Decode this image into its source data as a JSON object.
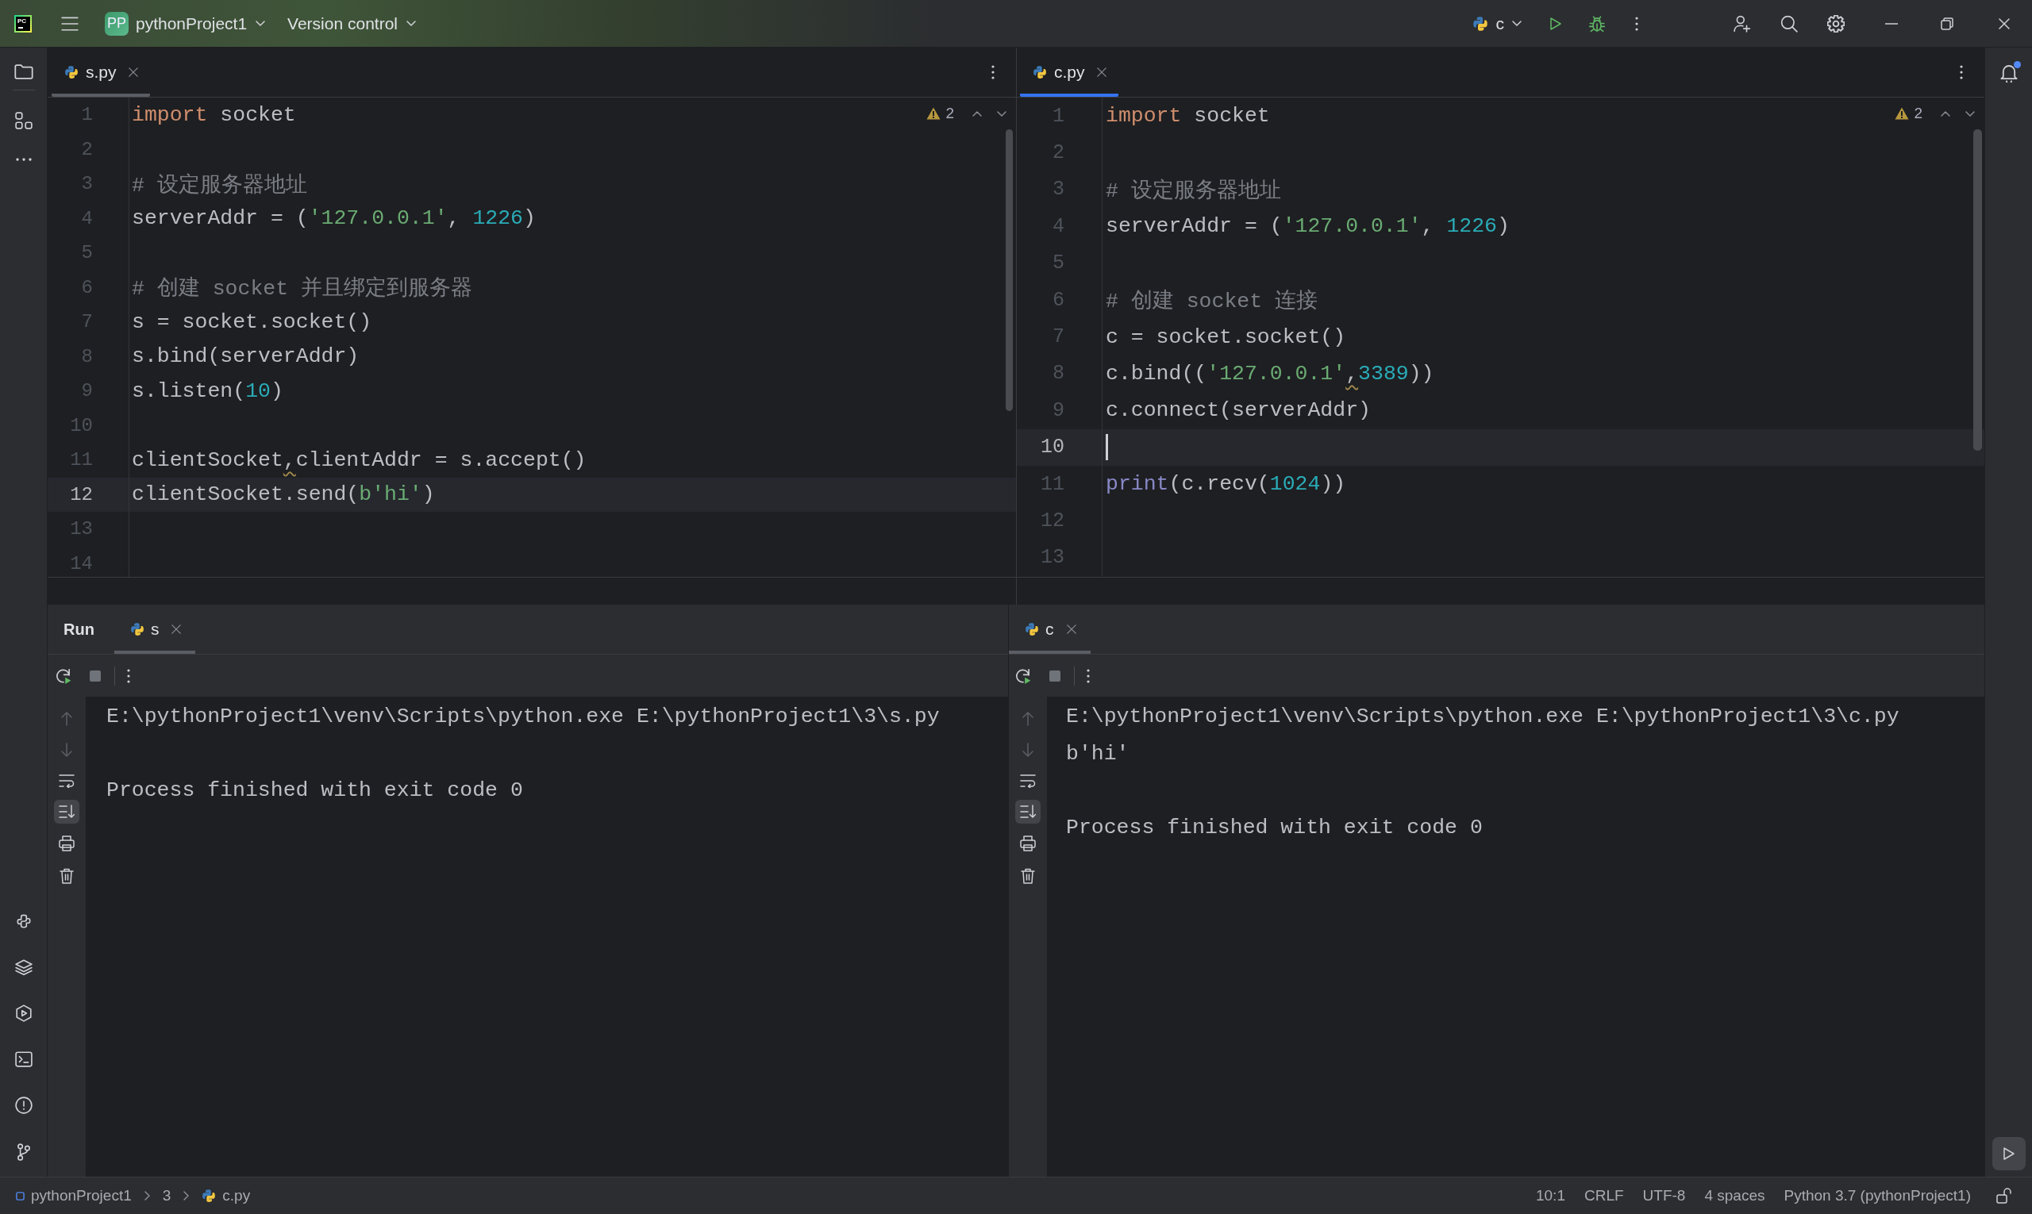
{
  "title_bar": {
    "app_logo": "PC",
    "project_badge": "PP",
    "project_name": "pythonProject1",
    "vcs_menu": "Version control",
    "run_configuration": "c"
  },
  "editors": [
    {
      "focused": false,
      "tabs": [
        {
          "label": "s.py",
          "selected": true
        }
      ],
      "warnings": "2",
      "lines": [
        {
          "number": "1",
          "current": false,
          "tokens": [
            {
              "kind": "keyword",
              "text": "import"
            },
            {
              "kind": "plain",
              "text": " socket"
            }
          ]
        },
        {
          "number": "2",
          "current": false
        },
        {
          "number": "3",
          "current": false,
          "tokens": [
            {
              "kind": "comment",
              "text": "# 设定服务器地址"
            }
          ]
        },
        {
          "number": "4",
          "current": false,
          "tokens": [
            {
              "kind": "plain",
              "text": "serverAddr = ("
            },
            {
              "kind": "string",
              "text": "'127.0.0.1'"
            },
            {
              "kind": "plain",
              "text": ", "
            },
            {
              "kind": "number",
              "text": "1226"
            },
            {
              "kind": "plain",
              "text": ")"
            }
          ]
        },
        {
          "number": "5",
          "current": false
        },
        {
          "number": "6",
          "current": false,
          "tokens": [
            {
              "kind": "comment",
              "text": "# 创建 socket 并且绑定到服务器"
            }
          ]
        },
        {
          "number": "7",
          "current": false,
          "tokens": [
            {
              "kind": "plain",
              "text": "s = socket.socket()"
            }
          ]
        },
        {
          "number": "8",
          "current": false,
          "tokens": [
            {
              "kind": "plain",
              "text": "s.bind(serverAddr)"
            }
          ]
        },
        {
          "number": "9",
          "current": false,
          "tokens": [
            {
              "kind": "plain",
              "text": "s.listen("
            },
            {
              "kind": "number",
              "text": "10"
            },
            {
              "kind": "plain",
              "text": ")"
            }
          ]
        },
        {
          "number": "10",
          "current": false
        },
        {
          "number": "11",
          "current": false,
          "tokens": [
            {
              "kind": "plain",
              "text": "clientSocket"
            },
            {
              "kind": "warning",
              "text": ","
            },
            {
              "kind": "plain",
              "text": "clientAddr = s.accept()"
            }
          ]
        },
        {
          "number": "12",
          "current": true,
          "tokens": [
            {
              "kind": "plain",
              "text": "clientSocket.send("
            },
            {
              "kind": "string",
              "text": "b'hi'"
            },
            {
              "kind": "plain",
              "text": ")"
            }
          ]
        },
        {
          "number": "13",
          "current": false
        },
        {
          "number": "14",
          "current": false
        }
      ]
    },
    {
      "focused": true,
      "tabs": [
        {
          "label": "c.py",
          "selected": true
        }
      ],
      "warnings": "2",
      "lines": [
        {
          "number": "1",
          "current": false,
          "tokens": [
            {
              "kind": "keyword",
              "text": "import"
            },
            {
              "kind": "plain",
              "text": " socket"
            }
          ]
        },
        {
          "number": "2",
          "current": false
        },
        {
          "number": "3",
          "current": false,
          "tokens": [
            {
              "kind": "comment",
              "text": "# 设定服务器地址"
            }
          ]
        },
        {
          "number": "4",
          "current": false,
          "tokens": [
            {
              "kind": "plain",
              "text": "serverAddr = ("
            },
            {
              "kind": "string",
              "text": "'127.0.0.1'"
            },
            {
              "kind": "plain",
              "text": ", "
            },
            {
              "kind": "number",
              "text": "1226"
            },
            {
              "kind": "plain",
              "text": ")"
            }
          ]
        },
        {
          "number": "5",
          "current": false
        },
        {
          "number": "6",
          "current": false,
          "tokens": [
            {
              "kind": "comment",
              "text": "# 创建 socket 连接"
            }
          ]
        },
        {
          "number": "7",
          "current": false,
          "tokens": [
            {
              "kind": "plain",
              "text": "c = socket.socket()"
            }
          ]
        },
        {
          "number": "8",
          "current": false,
          "tokens": [
            {
              "kind": "plain",
              "text": "c.bind(("
            },
            {
              "kind": "string",
              "text": "'127.0.0.1'"
            },
            {
              "kind": "warning",
              "text": ","
            },
            {
              "kind": "number",
              "text": "3389"
            },
            {
              "kind": "plain",
              "text": "))"
            }
          ]
        },
        {
          "number": "9",
          "current": false,
          "tokens": [
            {
              "kind": "plain",
              "text": "c.connect(serverAddr)"
            }
          ]
        },
        {
          "number": "10",
          "current": true
        },
        {
          "number": "11",
          "current": false,
          "tokens": [
            {
              "kind": "builtin",
              "text": "print"
            },
            {
              "kind": "plain",
              "text": "(c.recv("
            },
            {
              "kind": "number",
              "text": "1024"
            },
            {
              "kind": "plain",
              "text": "))"
            }
          ]
        },
        {
          "number": "12",
          "current": false
        },
        {
          "number": "13",
          "current": false
        }
      ]
    }
  ],
  "run_panel": {
    "title": "Run",
    "consoles": [
      {
        "tabs": [
          {
            "label": "s",
            "selected": true
          }
        ],
        "running": false,
        "soft_wrap": false,
        "scroll_to_end": true,
        "output": [
          "E:\\pythonProject1\\venv\\Scripts\\python.exe E:\\pythonProject1\\3\\s.py"
        ],
        "exit_message": "Process finished with exit code 0"
      },
      {
        "tabs": [
          {
            "label": "c",
            "selected": true
          }
        ],
        "running": false,
        "soft_wrap": false,
        "scroll_to_end": true,
        "output": [
          "E:\\pythonProject1\\venv\\Scripts\\python.exe E:\\pythonProject1\\3\\c.py",
          "b'hi'"
        ],
        "exit_message": "Process finished with exit code 0"
      }
    ]
  },
  "right_strip": {
    "notifications_unread": true,
    "run_selected": true
  },
  "status_bar": {
    "breadcrumbs": [
      "pythonProject1",
      "3",
      "c.py"
    ],
    "caret_position": "10:1",
    "line_separator": "CRLF",
    "encoding": "UTF-8",
    "indent": "4 spaces",
    "interpreter": "Python 3.7 (pythonProject1)"
  }
}
